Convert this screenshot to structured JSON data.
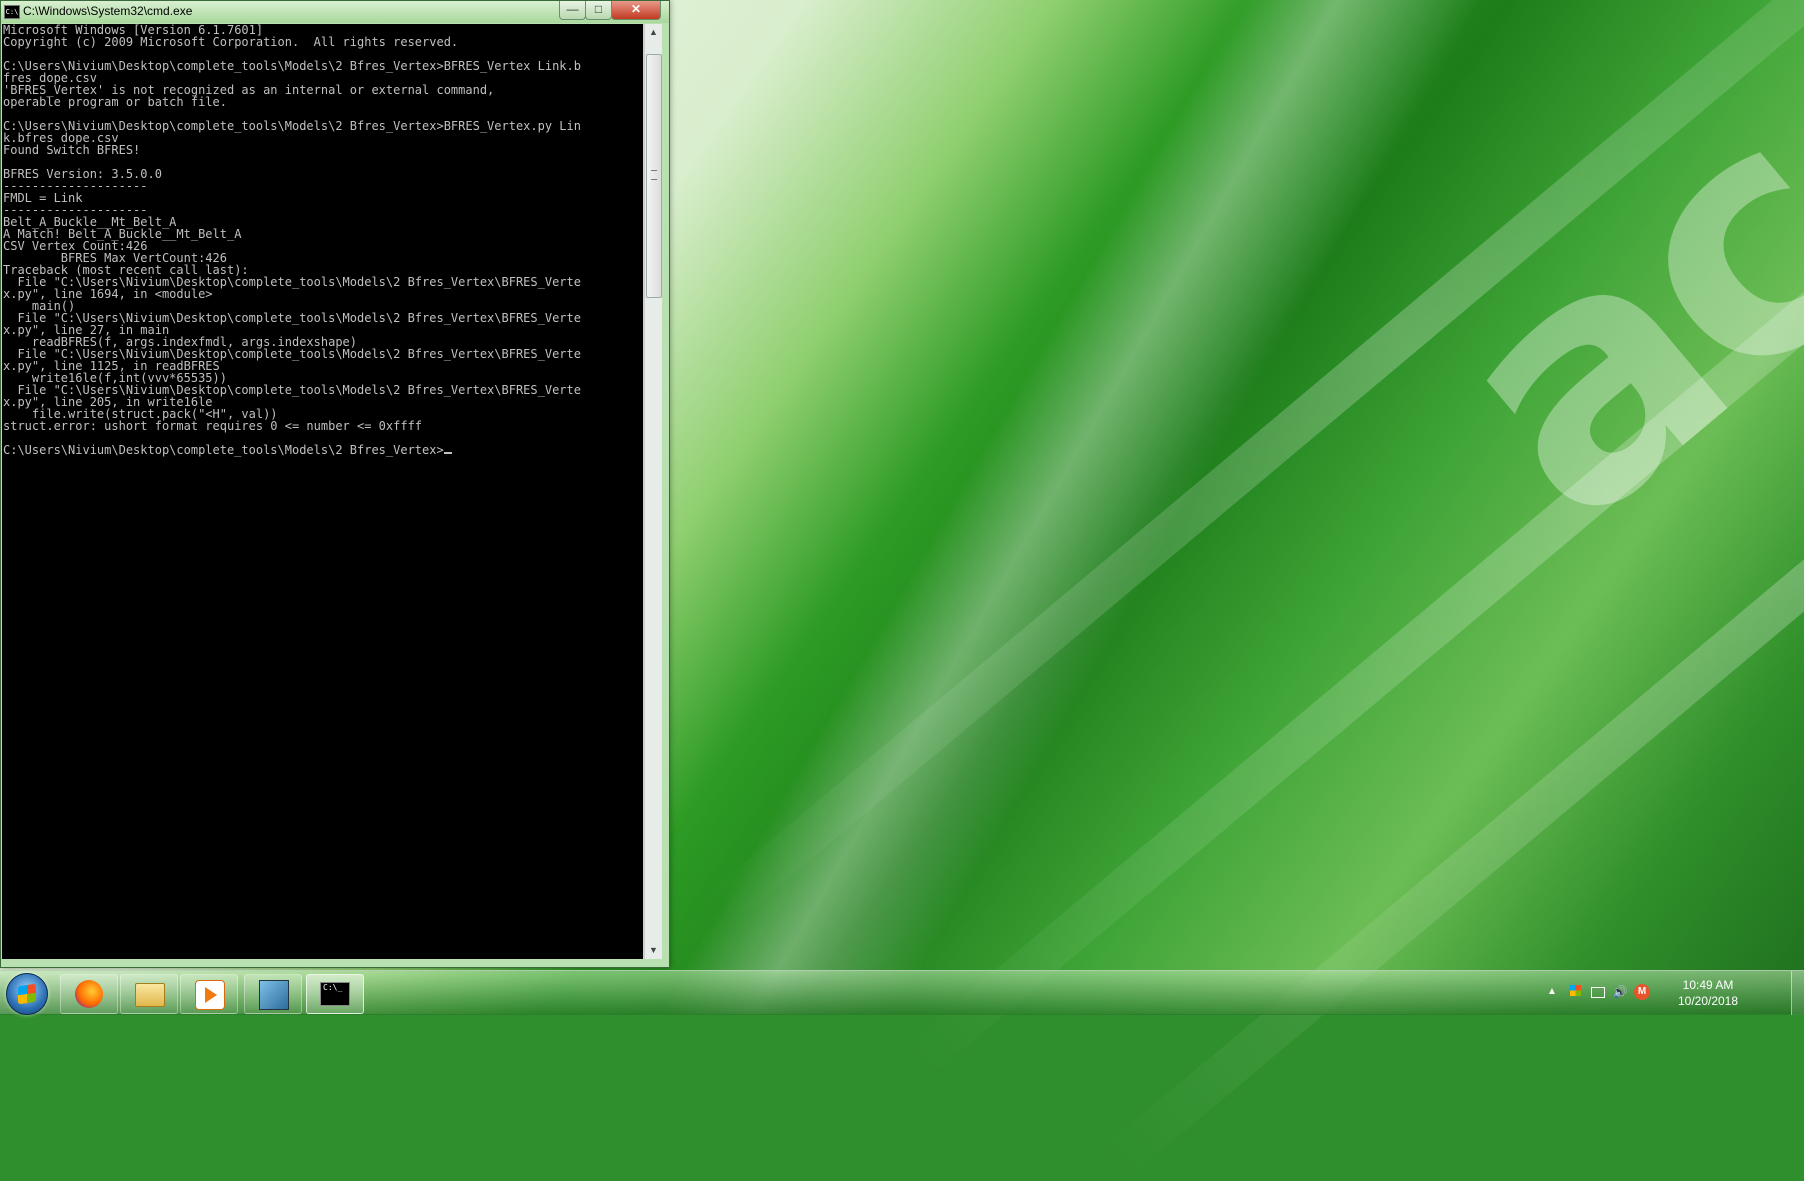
{
  "window": {
    "title": "C:\\Windows\\System32\\cmd.exe",
    "title_icon": "C:\\",
    "minimize_glyph": "—",
    "maximize_glyph": "□",
    "close_glyph": "✕"
  },
  "console": {
    "lines": [
      "Microsoft Windows [Version 6.1.7601]",
      "Copyright (c) 2009 Microsoft Corporation.  All rights reserved.",
      "",
      "C:\\Users\\Nivium\\Desktop\\complete_tools\\Models\\2 Bfres_Vertex>BFRES_Vertex Link.b",
      "fres dope.csv",
      "'BFRES_Vertex' is not recognized as an internal or external command,",
      "operable program or batch file.",
      "",
      "C:\\Users\\Nivium\\Desktop\\complete_tools\\Models\\2 Bfres_Vertex>BFRES_Vertex.py Lin",
      "k.bfres dope.csv",
      "Found Switch BFRES!",
      "",
      "BFRES Version: 3.5.0.0",
      "--------------------",
      "FMDL = Link",
      "--------------------",
      "Belt_A_Buckle__Mt_Belt_A",
      "A Match! Belt_A_Buckle__Mt_Belt_A",
      "CSV Vertex Count:426",
      "        BFRES Max VertCount:426",
      "Traceback (most recent call last):",
      "  File \"C:\\Users\\Nivium\\Desktop\\complete_tools\\Models\\2 Bfres_Vertex\\BFRES_Verte",
      "x.py\", line 1694, in <module>",
      "    main()",
      "  File \"C:\\Users\\Nivium\\Desktop\\complete_tools\\Models\\2 Bfres_Vertex\\BFRES_Verte",
      "x.py\", line 27, in main",
      "    readBFRES(f, args.indexfmdl, args.indexshape)",
      "  File \"C:\\Users\\Nivium\\Desktop\\complete_tools\\Models\\2 Bfres_Vertex\\BFRES_Verte",
      "x.py\", line 1125, in readBFRES",
      "    write16le(f,int(vvv*65535))",
      "  File \"C:\\Users\\Nivium\\Desktop\\complete_tools\\Models\\2 Bfres_Vertex\\BFRES_Verte",
      "x.py\", line 205, in write16le",
      "    file.write(struct.pack(\"<H\", val))",
      "struct.error: ushort format requires 0 <= number <= 0xffff",
      ""
    ],
    "prompt": "C:\\Users\\Nivium\\Desktop\\complete_tools\\Models\\2 Bfres_Vertex>"
  },
  "scrollbar": {
    "up_glyph": "▲",
    "down_glyph": "▼"
  },
  "wallpaper": {
    "logo_text": "acer"
  },
  "taskbar": {
    "apps": [
      {
        "name": "firefox",
        "icon": "firefox-icon"
      },
      {
        "name": "windows-explorer",
        "icon": "folder-icon"
      },
      {
        "name": "media-player",
        "icon": "play-icon"
      },
      {
        "name": "tool",
        "icon": "app-icon"
      },
      {
        "name": "command-prompt",
        "icon": "cmd-icon",
        "active": true,
        "label": "C:\\_"
      }
    ],
    "tray": {
      "arrow_glyph": "▲",
      "volume_glyph": "🔊",
      "m_label": "M",
      "time": "10:49 AM",
      "date": "10/20/2018"
    }
  },
  "colors": {
    "console_bg": "#000000",
    "console_text": "#c0c0c0",
    "wallpaper_green": "#2d9b24"
  }
}
